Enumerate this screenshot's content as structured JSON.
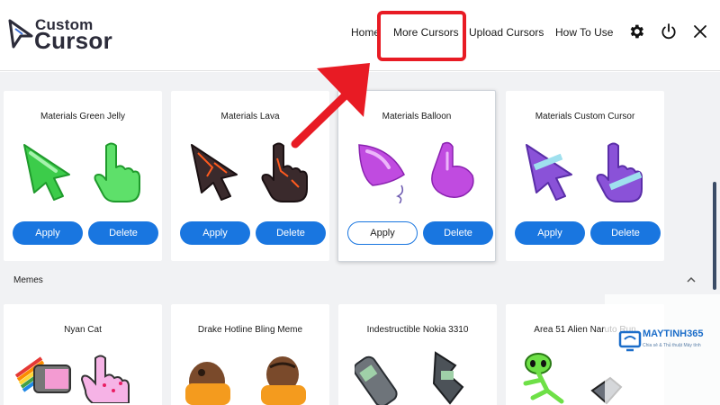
{
  "app": {
    "logo_line1": "Custom",
    "logo_line2": "Cursor"
  },
  "nav": {
    "home": "Home",
    "more_cursors": "More Cursors",
    "upload_cursors": "Upload Cursors",
    "how_to_use": "How To Use"
  },
  "icons": {
    "settings": "gear-icon",
    "power": "power-icon",
    "close": "close-icon",
    "collapse": "chevron-up-icon",
    "highlight_color": "#e81b24",
    "accent": "#1976e0"
  },
  "collection": {
    "cards": [
      {
        "title": "Materials Green Jelly",
        "apply": "Apply",
        "delete": "Delete",
        "selected": false
      },
      {
        "title": "Materials Lava",
        "apply": "Apply",
        "delete": "Delete",
        "selected": false
      },
      {
        "title": "Materials Balloon",
        "apply": "Apply",
        "delete": "Delete",
        "selected": true
      },
      {
        "title": "Materials Custom Cursor",
        "apply": "Apply",
        "delete": "Delete",
        "selected": false
      }
    ]
  },
  "memes": {
    "section_title": "Memes",
    "cards": [
      {
        "title": "Nyan Cat"
      },
      {
        "title": "Drake Hotline Bling Meme"
      },
      {
        "title": "Indestructible Nokia 3310"
      },
      {
        "title": "Area 51 Alien Naruto Run"
      }
    ]
  },
  "watermark": {
    "brand": "MAYTINH365",
    "tagline": "Chia sẻ & Thủ thuật Máy tính"
  }
}
